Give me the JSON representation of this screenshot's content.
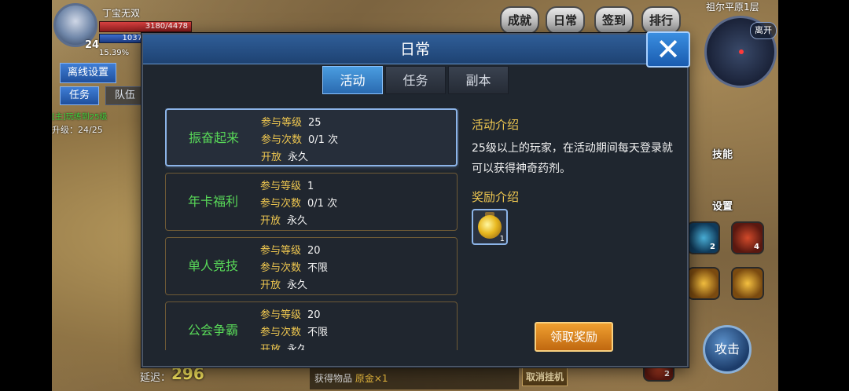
{
  "hud": {
    "player_name": "丁宝无双",
    "level": "24",
    "hp_text": "3180/4478",
    "mp_text": "1037",
    "exp_percent": "15.39%",
    "offline_settings": "离线设置",
    "task_button": "任务",
    "team_button": "队伍",
    "quest_line1": "[主]玩练到25级",
    "quest_line2": "升级：24/25"
  },
  "top_menu": {
    "achievement": "成就",
    "daily": "日常",
    "signin": "签到",
    "ranking": "排行"
  },
  "map": {
    "name": "祖尔平原1层",
    "leave": "离开"
  },
  "right_side": {
    "skills_label": "技能",
    "settings_label": "设置",
    "skill_counts": [
      "2",
      "4",
      "2"
    ],
    "attack": "攻击"
  },
  "bottom": {
    "latency_label": "延迟：",
    "latency_value": "296",
    "loot_prefix": "获得物品",
    "loot_item": "原金×1",
    "cancel_hook": "取消挂机"
  },
  "dialog": {
    "title": "日常",
    "tabs": [
      {
        "label": "活动",
        "active": true
      },
      {
        "label": "任务",
        "active": false
      },
      {
        "label": "副本",
        "active": false
      }
    ],
    "field_labels": {
      "level": "参与等级",
      "times": "参与次数",
      "open": "开放"
    },
    "activities": [
      {
        "name": "振奋起来",
        "level": "25",
        "times": "0/1 次",
        "open": "永久"
      },
      {
        "name": "年卡福利",
        "level": "1",
        "times": "0/1 次",
        "open": "永久"
      },
      {
        "name": "单人竞技",
        "level": "20",
        "times": "不限",
        "open": "永久"
      },
      {
        "name": "公会争霸",
        "level": "20",
        "times": "不限",
        "open": "永久"
      }
    ],
    "detail_title": "活动介绍",
    "detail_desc": "25级以上的玩家，在活动期间每天登录就可以获得神奇药剂。",
    "reward_title": "奖励介绍",
    "reward_count": "1",
    "claim_button": "领取奖励"
  }
}
